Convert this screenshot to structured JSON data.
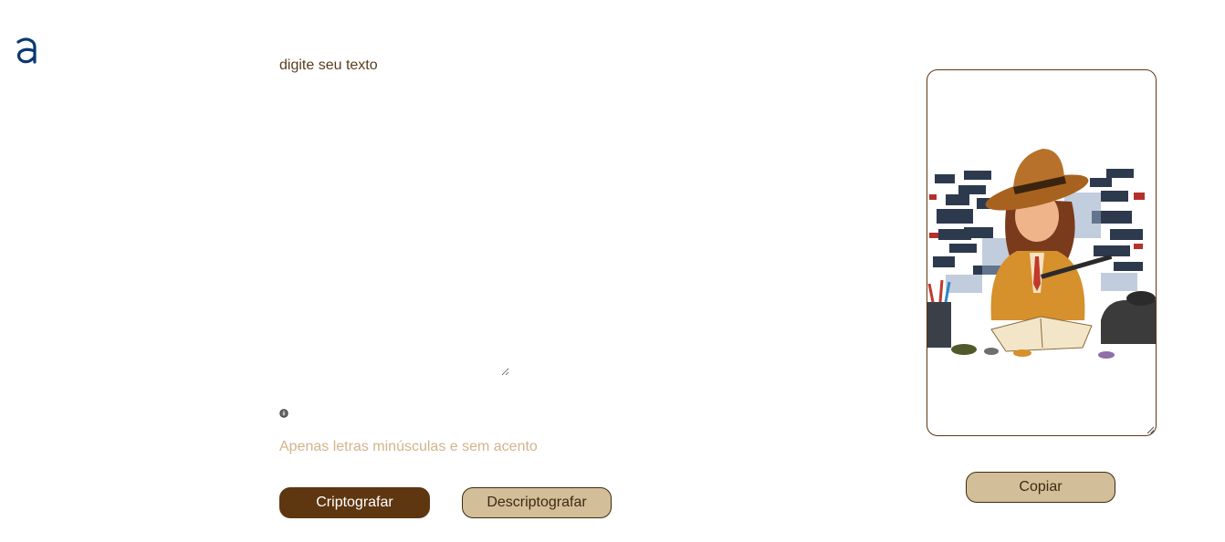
{
  "logo": {
    "icon": "alura-logo-icon",
    "color": "#0a3871"
  },
  "input": {
    "placeholder": "digite seu texto",
    "value": ""
  },
  "hint": {
    "icon": "info-icon",
    "text": "Apenas letras minúsculas e sem acento"
  },
  "buttons": {
    "encrypt_label": "Criptografar",
    "decrypt_label": "Descriptografar",
    "copy_label": "Copiar"
  },
  "output": {
    "image": "detective-girl-decoding-illustration"
  },
  "colors": {
    "primary": "#5e3610",
    "secondary": "#d2be98",
    "text": "#5a3d1c",
    "hint": "#d2b48c"
  }
}
